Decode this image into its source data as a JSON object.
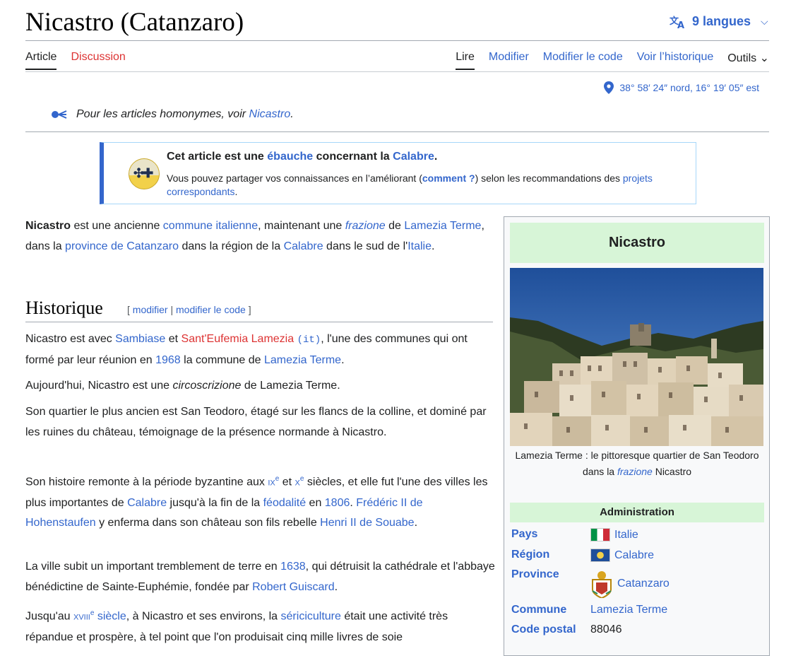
{
  "header": {
    "title": "Nicastro (Catanzaro)",
    "languages": "9 langues"
  },
  "tabs": {
    "article": "Article",
    "discussion": "Discussion",
    "read": "Lire",
    "edit": "Modifier",
    "edit_code": "Modifier le code",
    "history": "Voir l’historique",
    "tools": "Outils"
  },
  "coordinates": "38° 58′ 24″ nord, 16° 19′ 05″ est",
  "homonym": {
    "prefix": "Pour les articles homonymes, voir",
    "link": "Nicastro",
    "suffix": "."
  },
  "stub": {
    "l1_a": "Cet article est une",
    "l1_link1": "ébauche",
    "l1_b": "concernant la",
    "l1_link2": "Calabre",
    "l1_c": ".",
    "l2_a": "Vous pouvez partager vos connaissances en l’améliorant (",
    "l2_link1": "comment ?",
    "l2_b": ") selon les recommandations des",
    "l2_link2": "projets correspondants",
    "l2_c": "."
  },
  "intro": {
    "bold": "Nicastro",
    "t1": " est une ancienne ",
    "l1": "commune italienne",
    "t2": ", maintenant une ",
    "l2": "frazione",
    "t3": " de ",
    "l3": "Lamezia Terme",
    "t4": ", dans la ",
    "l4": "province de Catanzaro",
    "t5": " dans la région de la ",
    "l5": "Calabre",
    "t6": " dans le sud de l'",
    "l6": "Italie",
    "t7": "."
  },
  "section": {
    "heading": "Historique",
    "edit_open": "[",
    "edit": "modifier",
    "sep": "|",
    "edit_code": "modifier le code",
    "edit_close": "]"
  },
  "p1": {
    "t1": "Nicastro est avec ",
    "l1": "Sambiase",
    "t2": " et ",
    "l2": "Sant'Eufemia Lamezia",
    "it": "(it)",
    "t3": ", l'une des communes qui ont formé par leur réunion en ",
    "l3": "1968",
    "t4": " la commune de ",
    "l4": "Lamezia Terme",
    "t5": "."
  },
  "p2": {
    "t1": "Aujourd'hui, Nicastro est une ",
    "i1": "circoscrizione",
    "t2": " de Lamezia Terme."
  },
  "p3": "Son quartier le plus ancien est San Teodoro, étagé sur les flancs de la colline, et dominé par les ruines du château, témoignage de la présence normande à Nicastro.",
  "p4": {
    "t1": "Son histoire remonte à la période byzantine aux ",
    "c1": "ix",
    "s1": "e",
    "t2": " et ",
    "c2": "x",
    "s2": "e",
    "t3": " siècles, et elle fut l'une des villes les plus importantes de ",
    "l1": "Calabre",
    "t4": " jusqu'à la fin de la ",
    "l2": "féodalité",
    "t5": " en ",
    "l3": "1806",
    "t6": ". ",
    "l4": "Frédéric II de Hohenstaufen",
    "t7": " y enferma dans son château son fils rebelle ",
    "l5": "Henri II de Souabe",
    "t8": "."
  },
  "p5": {
    "t1": "La ville subit un important tremblement de terre en ",
    "l1": "1638",
    "t2": ", qui détruisit la cathédrale et l'abbaye bénédictine de Sainte-Euphémie, fondée par ",
    "l2": "Robert Guiscard",
    "t3": "."
  },
  "p6": {
    "t1": "Jusqu'au ",
    "c1": "xviii",
    "s1": "e",
    "l1": " siècle",
    "t2": ", à Nicastro et ses environs, la ",
    "l2": "sériciculture",
    "t3": " était une activité très répandue et prospère, à tel point que l'on produisait cinq mille livres de soie"
  },
  "infobox": {
    "title": "Nicastro",
    "caption_a": "Lamezia Terme : le pittoresque quartier de San Teodoro",
    "caption_b": "dans la ",
    "caption_link": "frazione",
    "caption_c": " Nicastro",
    "admin": "Administration",
    "rows": [
      {
        "key": "Pays",
        "value": "Italie"
      },
      {
        "key": "Région",
        "value": "Calabre"
      },
      {
        "key": "Province",
        "value": "Catanzaro"
      },
      {
        "key": "Commune",
        "value": "Lamezia Terme"
      },
      {
        "key": "Code postal",
        "value": "88046"
      }
    ]
  },
  "colors": {
    "link": "#3366cc",
    "redlink": "#dd3333",
    "infobox_header": "#d7f5d7",
    "stub_border": "#3366cc"
  }
}
